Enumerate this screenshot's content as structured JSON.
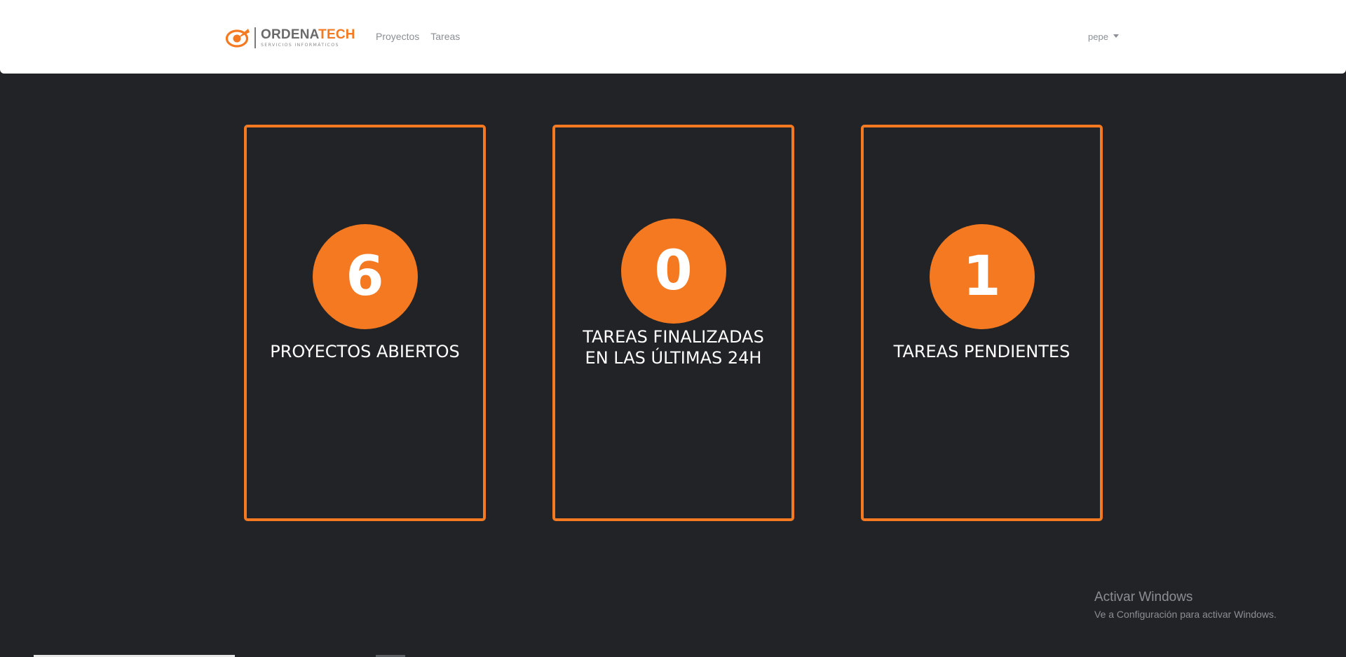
{
  "navbar": {
    "brand": {
      "name_part1": "ORDENA",
      "name_part2": "TECH",
      "tagline": "SERVICIOS INFORMÁTICOS",
      "logo_icon": "ordenatech-logo-icon",
      "color_primary": "#f47920",
      "color_secondary": "#6a6a6a"
    },
    "links": [
      {
        "label": "Proyectos"
      },
      {
        "label": "Tareas"
      }
    ],
    "user": {
      "label": "pepe",
      "icon": "caret-down-icon"
    }
  },
  "stats": [
    {
      "value": "6",
      "label": "PROYECTOS ABIERTOS"
    },
    {
      "value": "0",
      "label_line1": "TAREAS FINALIZADAS",
      "label_line2": "EN LAS ÚLTIMAS 24H"
    },
    {
      "value": "1",
      "label": "TAREAS PENDIENTES"
    }
  ],
  "watermark": {
    "title": "Activar Windows",
    "subtitle": "Ve a Configuración para activar Windows."
  },
  "colors": {
    "accent": "#f47920",
    "background": "#212327",
    "navbar": "#ffffff"
  }
}
